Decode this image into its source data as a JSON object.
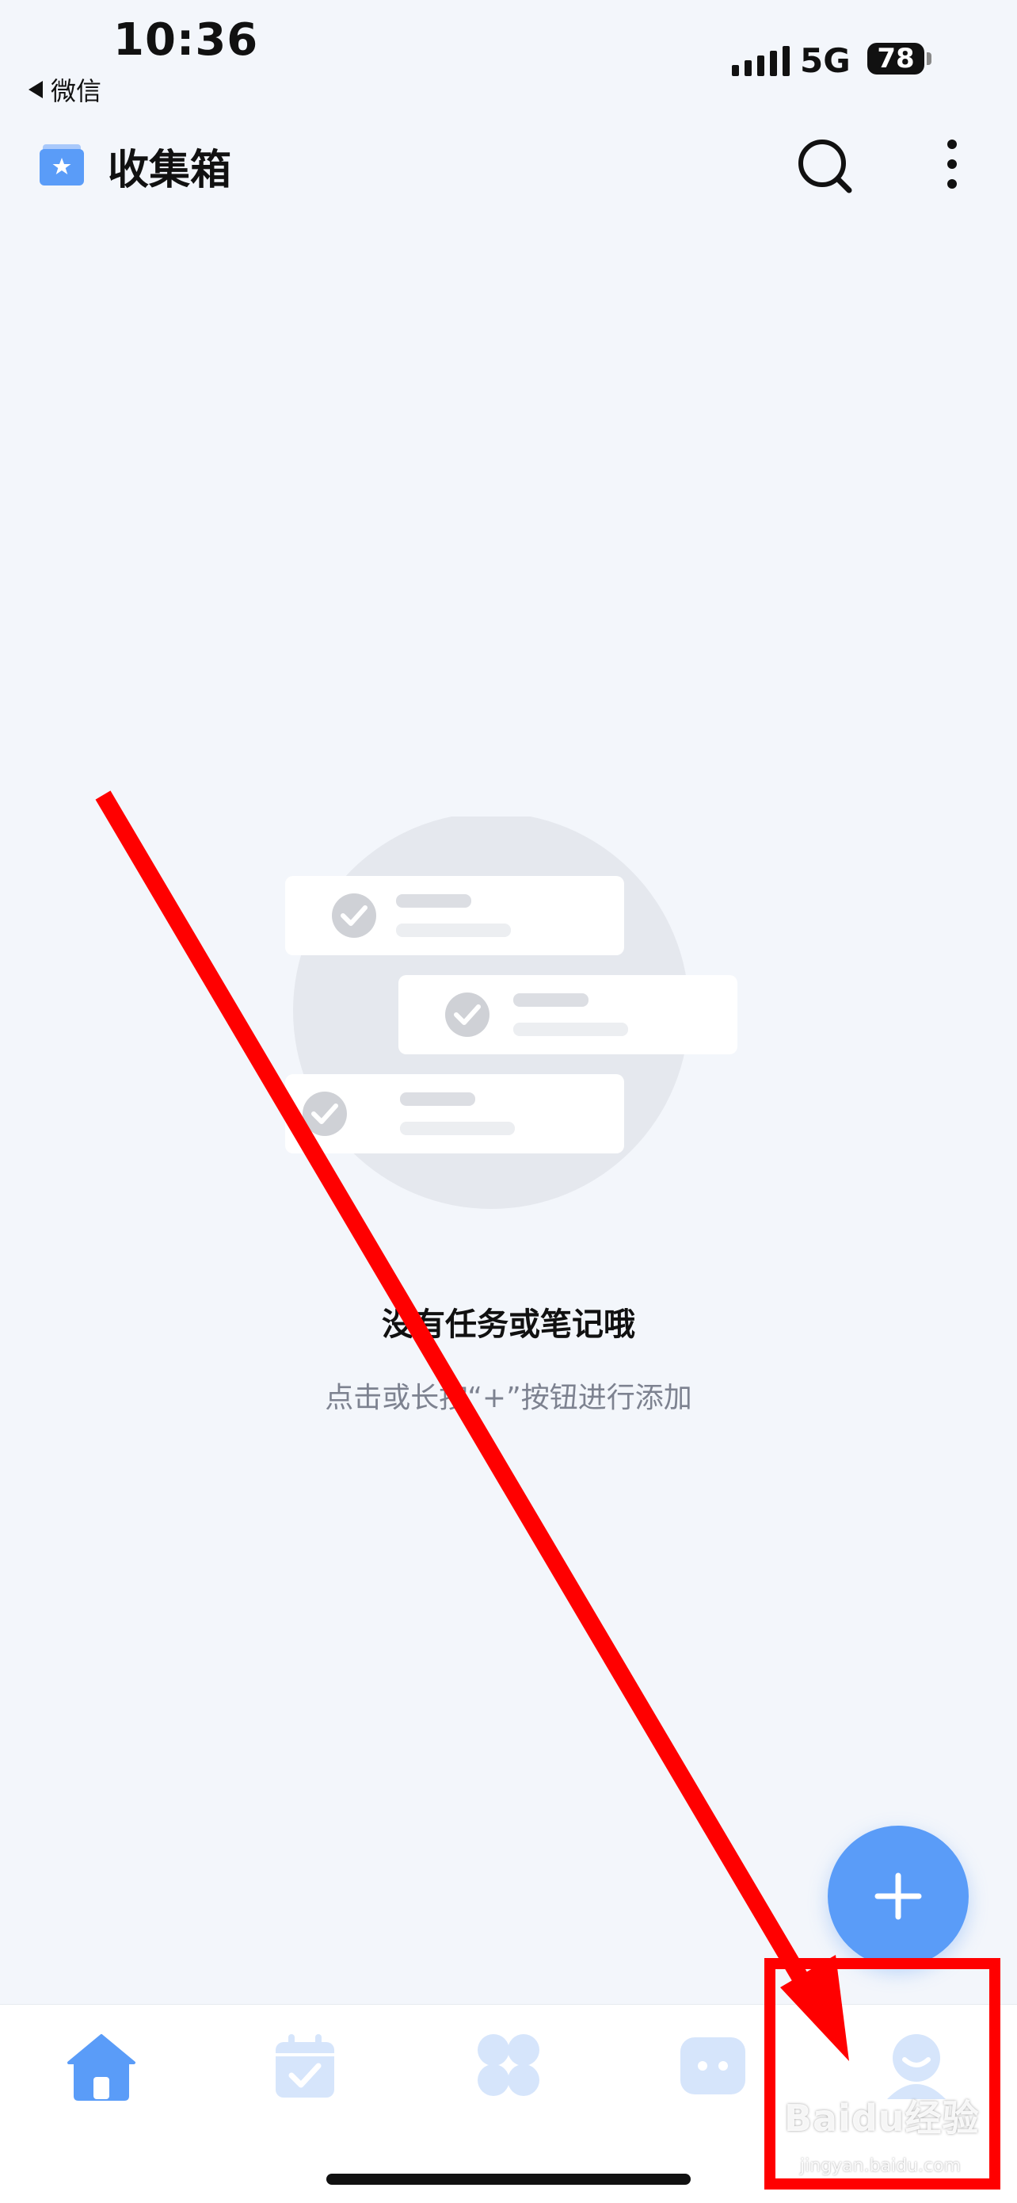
{
  "status_bar": {
    "time": "10:36",
    "back_app": "微信",
    "network": "5G",
    "battery": "78"
  },
  "header": {
    "title": "收集箱"
  },
  "empty_state": {
    "title": "没有任务或笔记哦",
    "subtitle": "点击或长按“+”按钮进行添加"
  },
  "tabs": [
    {
      "icon": "home-icon",
      "active": true
    },
    {
      "icon": "calendar-check-icon",
      "active": false
    },
    {
      "icon": "grid-icon",
      "active": false
    },
    {
      "icon": "robot-icon",
      "active": false
    },
    {
      "icon": "profile-icon",
      "active": false
    }
  ],
  "colors": {
    "accent": "#5a9cf8",
    "inactive_icon": "#d6e5fb",
    "background": "#f3f6fb",
    "annotation": "#ff0000"
  },
  "watermark": {
    "brand": "Baidu经验",
    "url": "jingyan.baidu.com"
  }
}
